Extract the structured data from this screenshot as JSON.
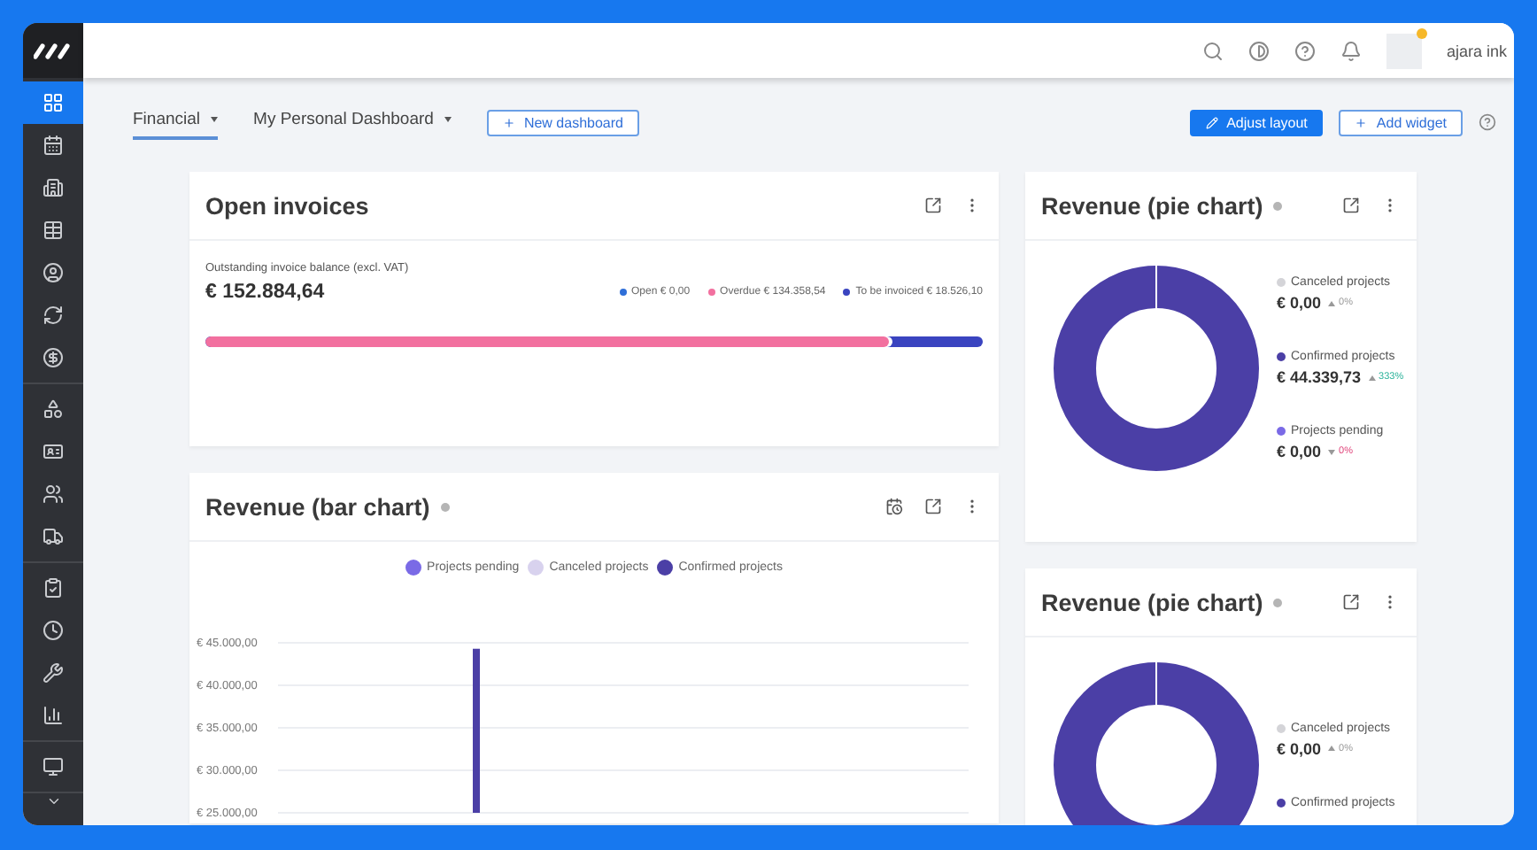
{
  "sidebar": {
    "groups": [
      [
        {
          "selected": true
        },
        {
          "selected": false
        },
        {
          "selected": false
        },
        {
          "selected": false
        },
        {
          "selected": false
        },
        {
          "selected": false
        },
        {
          "selected": false
        }
      ],
      [
        {
          "selected": false
        },
        {
          "selected": false
        },
        {
          "selected": false
        },
        {
          "selected": false
        }
      ],
      [
        {
          "selected": false
        },
        {
          "selected": false
        },
        {
          "selected": false
        },
        {
          "selected": false
        }
      ],
      [
        {
          "selected": false
        }
      ]
    ]
  },
  "topbar": {
    "user": "ajara ink"
  },
  "tabs": [
    {
      "label": "Financial",
      "selected": true
    },
    {
      "label": "My Personal Dashboard",
      "selected": false
    }
  ],
  "new_dashboard": "New dashboard",
  "actions": {
    "adjust": "Adjust layout",
    "add": "Add widget"
  },
  "open_invoices": {
    "title": "Open invoices",
    "caption": "Outstanding invoice balance (excl. VAT)",
    "total": "€ 152.884,64",
    "legend": [
      {
        "label": "Open € 0,00",
        "color": "#2f6fd8"
      },
      {
        "label": "Overdue € 134.358,54",
        "color": "#f2709f"
      },
      {
        "label": "To be invoiced € 18.526,10",
        "color": "#3a44c0"
      }
    ],
    "bar": {
      "level": 0.879
    }
  },
  "bar_card": {
    "title": "Revenue (bar chart)",
    "chart_data": {
      "type": "bar",
      "categories": [
        null,
        null,
        null,
        null,
        null,
        null,
        null,
        null,
        null,
        null,
        null,
        null
      ],
      "series": [
        {
          "name": "Projects pending",
          "color": "#7a6ae6",
          "values": [
            null,
            null,
            null,
            null,
            null,
            null,
            null,
            null,
            null,
            null,
            null,
            null
          ]
        },
        {
          "name": "Canceled projects",
          "color": "#d8d2ee",
          "values": [
            null,
            null,
            null,
            null,
            null,
            null,
            null,
            null,
            null,
            null,
            null,
            null
          ]
        },
        {
          "name": "Confirmed projects",
          "color": "#4b3fa6",
          "values": [
            null,
            null,
            null,
            44300,
            null,
            null,
            null,
            null,
            null,
            null,
            null,
            null
          ]
        }
      ],
      "ylim": [
        25000,
        45000
      ],
      "grid": true,
      "yticks": [
        {
          "value": 45000,
          "label": "€ 45.000,00"
        },
        {
          "value": 40000,
          "label": "€ 40.000,00"
        },
        {
          "value": 35000,
          "label": "€ 35.000,00"
        },
        {
          "value": 30000,
          "label": "€ 30.000,00"
        },
        {
          "value": 25000,
          "label": "€ 25.000,00"
        }
      ]
    }
  },
  "pie_cards": [
    {
      "title": "Revenue (pie chart)",
      "legend": [
        {
          "label": "Canceled projects",
          "value": "€ 0,00",
          "change": "0%",
          "kind": "neutral",
          "color": "#d4d4d8"
        },
        {
          "label": "Confirmed projects",
          "value": "€ 44.339,73",
          "change": "333%",
          "kind": "up",
          "color": "#4b3fa6"
        },
        {
          "label": "Projects pending",
          "value": "€ 0,00",
          "change": "0%",
          "kind": "down",
          "color": "#7a6ae6"
        }
      ]
    },
    {
      "title": "Revenue (pie chart)",
      "legend": [
        {
          "label": "Canceled projects",
          "value": "€ 0,00",
          "change": "0%",
          "kind": "neutral",
          "color": "#d4d4d8"
        },
        {
          "label": "Confirmed projects",
          "color": "#4b3fa6"
        }
      ]
    }
  ]
}
